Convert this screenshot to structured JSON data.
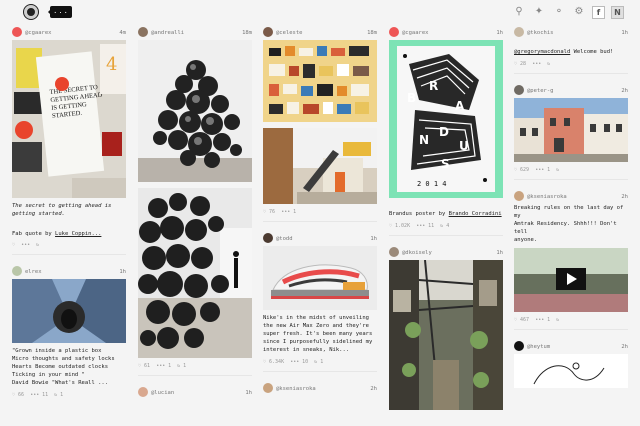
{
  "topbar": {
    "feed_label": "...",
    "icons": [
      "search-icon",
      "sparkle-icon",
      "mic-icon",
      "settings-icon"
    ],
    "btn_f": "f",
    "btn_n": "N"
  },
  "columns": [
    {
      "cards": [
        {
          "user": "@cgaarex",
          "time": "4m",
          "caption": "The secret to getting ahead is\ngetting started.",
          "quote_prefix": "Fab quote by ",
          "quote_link": "Luke Coppin...",
          "stats": []
        },
        {
          "user": "elrex",
          "time": "1h",
          "caption": "\"Grown inside a plastic box\nMicro thoughts and safety locks\nHearts Become outdated clocks\nTicking in your mind \"\nDavid Bowie \"What's Reall ...",
          "stats": [
            "66",
            "11",
            "1"
          ]
        }
      ]
    },
    {
      "cards": [
        {
          "user": "@andrealli",
          "time": "18m",
          "stats": [
            "61",
            "1",
            "1"
          ]
        },
        {
          "user": "@lucian",
          "time": "1h",
          "stats": []
        }
      ]
    },
    {
      "cards": [
        {
          "user": "@celeste",
          "time": "18m",
          "stats": [
            "76",
            "1"
          ]
        },
        {
          "user": "@todd",
          "time": "1h",
          "caption": "Nike's in the midst of unveiling\nthe new Air Max Zero and they're\nsuper fresh. It's been many years\nsince I purposefully sidelined my\ninterest in sneaks, Nik...",
          "stats": [
            "6.34K",
            "10",
            "1"
          ]
        },
        {
          "user": "@kseniasroka",
          "time": "2h",
          "stats": []
        }
      ]
    },
    {
      "cards": [
        {
          "user": "@cgaarex",
          "time": "1h",
          "caption_prefix": "Brandus poster by ",
          "caption_link": "Brando Corradini",
          "stats": [
            "1.02K",
            "11",
            "4"
          ]
        },
        {
          "user": "@dkoisely",
          "time": "1h",
          "stats": []
        }
      ]
    },
    {
      "cards": [
        {
          "user": "@tkochis",
          "time": "1h",
          "mention": "@gregorymacdonald",
          "caption": " Welcome bud!",
          "stats": [
            "28"
          ]
        },
        {
          "user": "@peter-g",
          "time": "2h",
          "stats": [
            "629",
            "1"
          ]
        },
        {
          "user": "@kseniasroka",
          "time": "2h",
          "caption": "Breaking rules on the last day of my\nAmtrak Residency. Shhh!!! Don't tell\nanyone.",
          "stats": [
            "467",
            "1"
          ]
        },
        {
          "user": "@heytum",
          "time": "2h",
          "stats": []
        }
      ]
    }
  ],
  "poster_text": [
    "B",
    "R",
    "A",
    "N",
    "D",
    "U",
    "S"
  ],
  "poster_year": "2 0 1 4",
  "book_cover": {
    "title": "THE SECRET TO GETTING AHEAD IS GETTING STARTED.",
    "number": "4"
  }
}
